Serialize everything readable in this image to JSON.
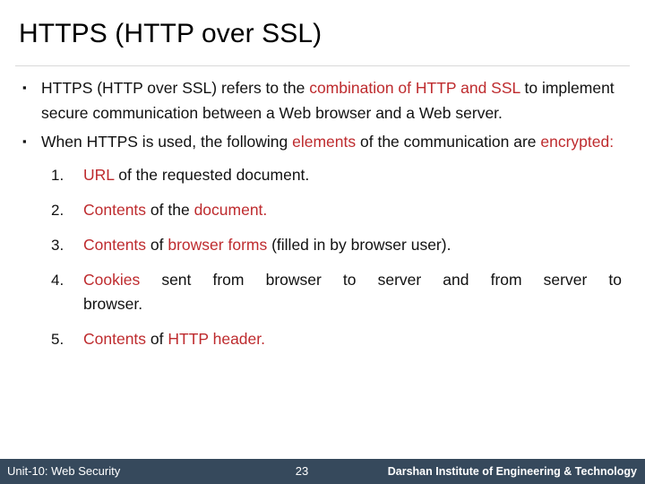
{
  "slide": {
    "title": "HTTPS (HTTP over SSL)",
    "accent_color": "#BE2B2E",
    "footer_bar_color": "#36495C",
    "text_color": "#111111"
  },
  "bullets": [
    {
      "marker": "▪",
      "line1_plain_a": "HTTPS (HTTP over SSL) refers to the ",
      "line1_red": "combination of HTTP and SSL",
      "line2": "to implement secure communication between a Web browser and",
      "line3": "a Web server."
    },
    {
      "marker": "▪",
      "line1_plain_a": "When HTTPS is used, the following ",
      "line1_red": "elements",
      "line1_plain_b": " of the",
      "line2_plain_a": "communication are ",
      "line2_red": "encrypted:"
    }
  ],
  "numbered_list": [
    {
      "number": "1.",
      "red_a": "URL",
      "plain_a": " of the requested document."
    },
    {
      "number": "2.",
      "red_a": "Contents",
      "plain_a": " of the ",
      "red_b": "document."
    },
    {
      "number": "3.",
      "red_a": "Contents",
      "plain_a": " of ",
      "red_b": "browser forms",
      "plain_b": " (filled in by browser user)."
    },
    {
      "number": "4.",
      "red_a": "Cookies",
      "plain_a": " sent from browser to server and from server to",
      "line2": "browser."
    },
    {
      "number": "5.",
      "red_a": "Contents",
      "plain_a": " of ",
      "red_b": "HTTP header."
    }
  ],
  "footer": {
    "left": "Unit-10: Web Security",
    "page_number": "23",
    "right": "Darshan Institute of Engineering & Technology"
  }
}
